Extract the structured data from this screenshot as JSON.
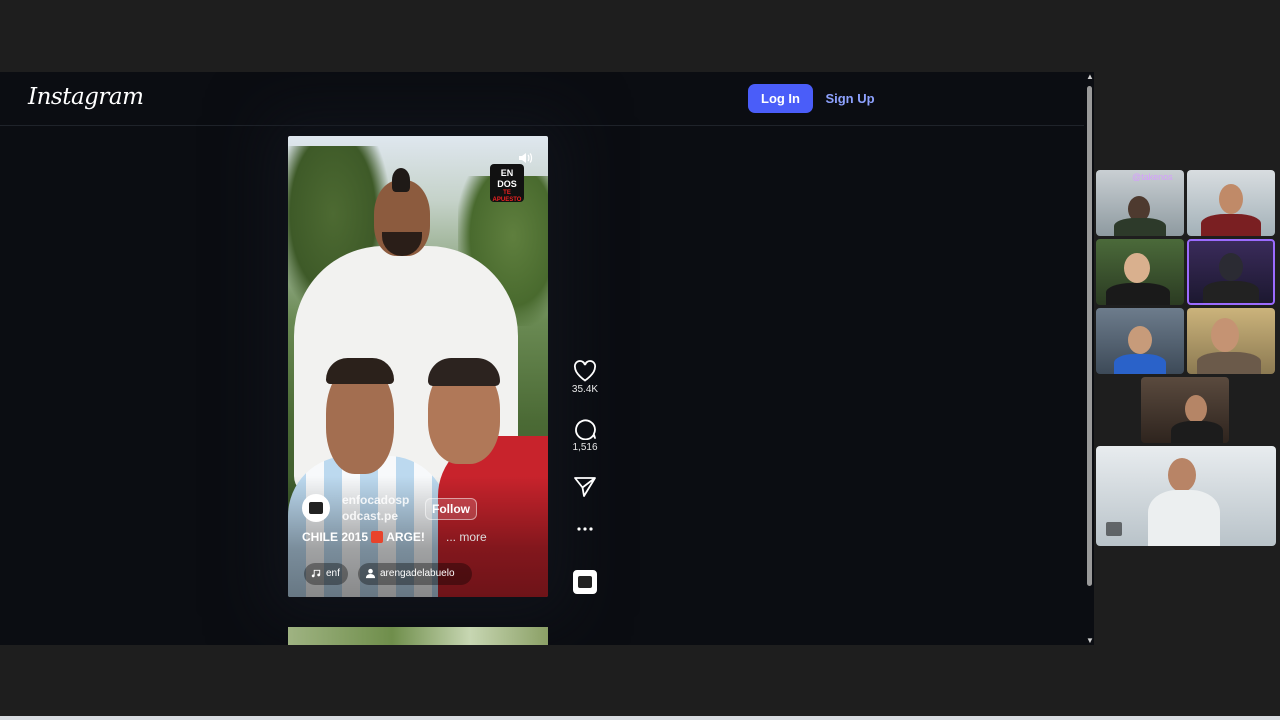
{
  "header": {
    "logo": "Instagram",
    "login_label": "Log In",
    "signup_label": "Sign Up"
  },
  "reel": {
    "channel_logo": "EN DOS",
    "channel_logo_sub": "TE APUESTO",
    "username": "enfocadosp odcast.pe",
    "follow_label": "Follow",
    "caption_prefix": "CHILE 2015",
    "caption_suffix": "ARGE!",
    "more_label": "... more",
    "audio_label": "enf",
    "tagged_user": "arengadelabuelo"
  },
  "actions": {
    "likes": "35.4K",
    "comments": "1,516"
  },
  "streamer_panel": {
    "tag": "@takenos"
  },
  "colors": {
    "accent": "#4a5df9",
    "signup_text": "#8ea2ff",
    "page_bg": "#0b0d12"
  }
}
